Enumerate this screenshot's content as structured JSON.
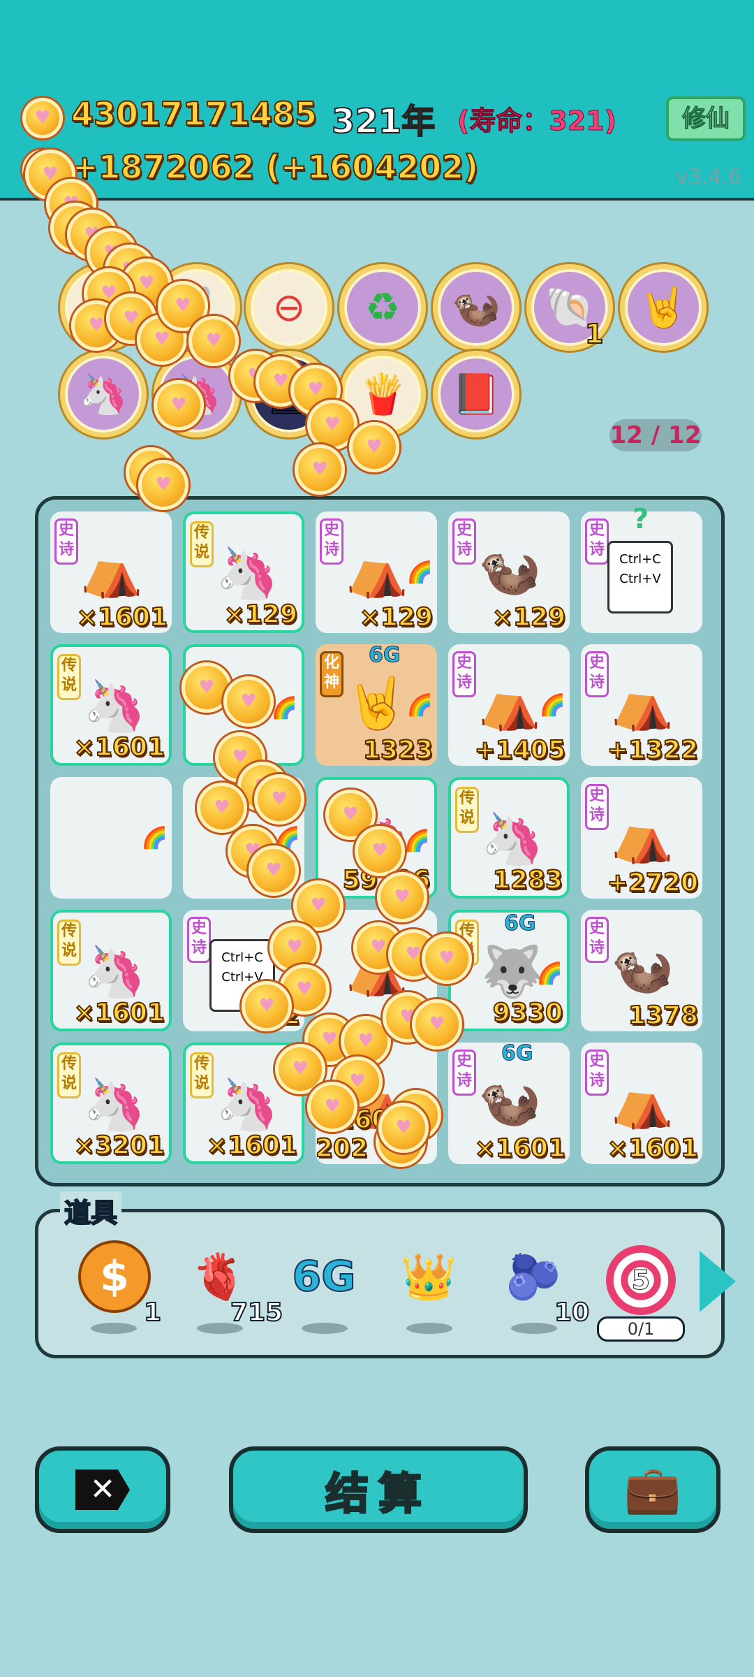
{
  "header": {
    "total_coins": "43017171485",
    "year": "321年",
    "lifespan": "(寿命：321)",
    "rate": "+1872062 (+1604202)",
    "cultivate_button": "修仙",
    "version": "v3.4.6"
  },
  "relics": {
    "shell_count": "1",
    "slots": "12 / 12"
  },
  "board": {
    "cells": [
      {
        "tag": "史诗",
        "num": "×1601"
      },
      {
        "tag": "传说",
        "num": "×129"
      },
      {
        "tag": "史诗",
        "num": "×129"
      },
      {
        "tag": "史诗",
        "num": "×129"
      },
      {
        "tag": "史诗",
        "num": ""
      },
      {
        "tag": "传说",
        "num": "×1601"
      },
      {
        "tag": "",
        "num": ""
      },
      {
        "tag": "化神",
        "num": "1323",
        "badge": "6G"
      },
      {
        "tag": "史诗",
        "num": "+1405"
      },
      {
        "tag": "史诗",
        "num": "+1322"
      },
      {
        "tag": "",
        "num": ""
      },
      {
        "tag": "",
        "num": ""
      },
      {
        "tag": "",
        "num": "59206"
      },
      {
        "tag": "传说",
        "num": "1283"
      },
      {
        "tag": "史诗",
        "num": "+2720"
      },
      {
        "tag": "传说",
        "num": "×1601"
      },
      {
        "tag": "史诗",
        "num": "2"
      },
      {
        "tag": "",
        "num": ""
      },
      {
        "tag": "传说",
        "num": "9330",
        "badge": "6G"
      },
      {
        "tag": "史诗",
        "num": "1378"
      },
      {
        "tag": "传说",
        "num": "×3201"
      },
      {
        "tag": "传说",
        "num": "×1601"
      },
      {
        "tag": "",
        "num": "+160 202"
      },
      {
        "tag": "史诗",
        "num": "×1601",
        "badge": "6G"
      },
      {
        "tag": "史诗",
        "num": "×1601"
      }
    ],
    "ctrl_text": "Ctrl+C Ctrl+V",
    "question": "?"
  },
  "props": {
    "title": "道具",
    "coin_count": "1",
    "liver_count": "715",
    "sixg_label": "6G",
    "blueberry_count": "10",
    "target_value": "5",
    "target_quota": "0/1"
  },
  "buttons": {
    "settle": "结算"
  },
  "colors": {
    "header_bg": "#21c0c0",
    "page_bg": "#a8d8dc",
    "accent_gold": "#ffd23f",
    "epic_purple": "#c14fd2",
    "legend_yellow": "#e3bb35"
  }
}
